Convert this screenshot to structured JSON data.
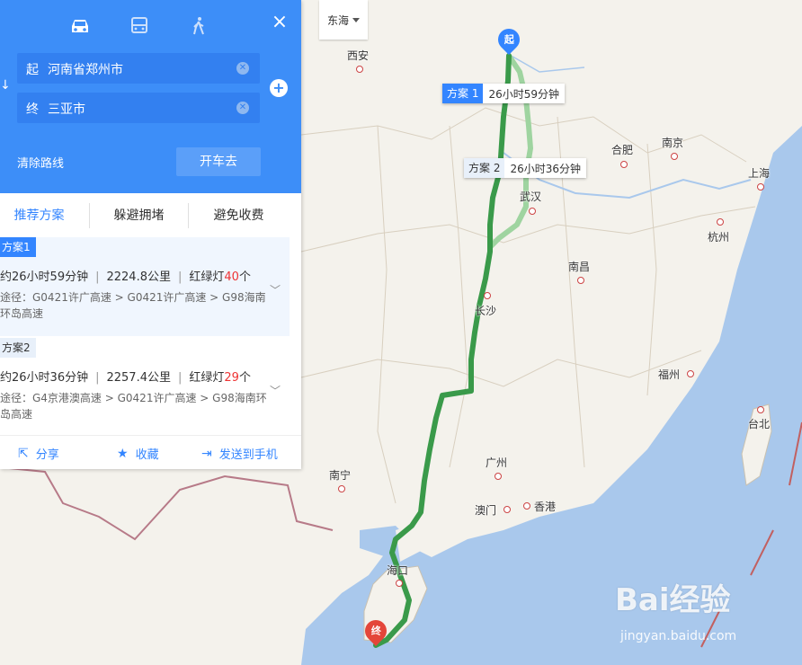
{
  "map": {
    "city_select": "东海",
    "cities": [
      {
        "name": "西安",
        "key": "xian"
      },
      {
        "name": "合肥",
        "key": "hefei"
      },
      {
        "name": "南京",
        "key": "nanjing"
      },
      {
        "name": "上海",
        "key": "shanghai"
      },
      {
        "name": "武汉",
        "key": "wuhan"
      },
      {
        "name": "杭州",
        "key": "hangzhou"
      },
      {
        "name": "南昌",
        "key": "nanchang"
      },
      {
        "name": "长沙",
        "key": "changsha"
      },
      {
        "name": "福州",
        "key": "fuzhou"
      },
      {
        "name": "台北",
        "key": "taibei"
      },
      {
        "name": "广州",
        "key": "guangzhou"
      },
      {
        "name": "南宁",
        "key": "nanning"
      },
      {
        "name": "澳门",
        "key": "aomen"
      },
      {
        "name": "香港",
        "key": "xianggang"
      },
      {
        "name": "海口",
        "key": "haikou"
      }
    ],
    "start_pin": "起",
    "end_pin": "终",
    "route_tags": [
      {
        "name": "方案 1",
        "time": "26小时59分钟"
      },
      {
        "name": "方案 2",
        "time": "26小时36分钟"
      }
    ],
    "colors": {
      "route_main": "#3a9a4a",
      "route_alt": "#9fd4a0",
      "start_pin": "#3385ff",
      "end_pin": "#e4463a",
      "water": "#a9c8ec",
      "land": "#f4f2ec"
    },
    "watermark": "Bai经验",
    "watermark_url": "jingyan.baidu.com"
  },
  "panel": {
    "modes": [
      "car-icon",
      "bus-icon",
      "walk-icon"
    ],
    "close": "×",
    "start": {
      "label": "起",
      "value": "河南省郑州市"
    },
    "end": {
      "label": "终",
      "value": "三亚市"
    },
    "clear_route": "清除路线",
    "drive_button": "开车去",
    "tabs": [
      "推荐方案",
      "躲避拥堵",
      "避免收费"
    ],
    "plans": [
      {
        "badge": "方案1",
        "time": "约26小时59分钟",
        "distance": "2224.8公里",
        "lights_prefix": "红绿灯",
        "lights_count": "40",
        "lights_suffix": "个",
        "path": "途径：G0421许广高速 > G0421许广高速 > G98海南环岛高速"
      },
      {
        "badge": "方案2",
        "time": "约26小时36分钟",
        "distance": "2257.4公里",
        "lights_prefix": "红绿灯",
        "lights_count": "29",
        "lights_suffix": "个",
        "path": "途径：G4京港澳高速 > G0421许广高速 > G98海南环岛高速"
      }
    ],
    "actions": [
      {
        "icon": "share-icon",
        "label": "分享"
      },
      {
        "icon": "star-icon",
        "label": "收藏"
      },
      {
        "icon": "send-icon",
        "label": "发送到手机"
      }
    ]
  }
}
